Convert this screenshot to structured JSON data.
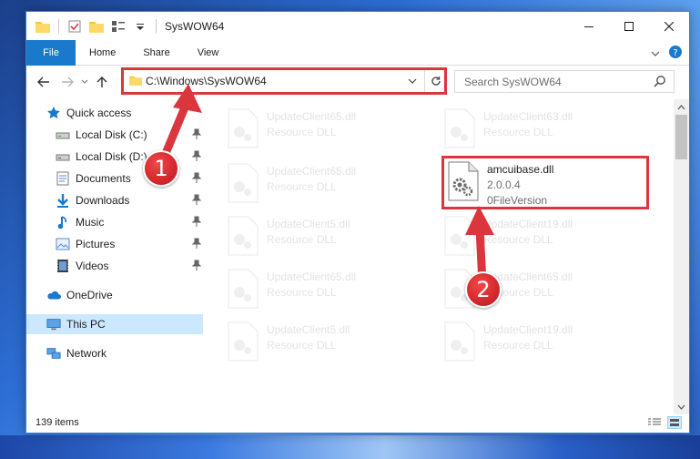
{
  "window": {
    "title": "SysWOW64"
  },
  "ribbon": {
    "tabs": [
      {
        "label": "File"
      },
      {
        "label": "Home"
      },
      {
        "label": "Share"
      },
      {
        "label": "View"
      }
    ]
  },
  "address": {
    "path": "C:\\Windows\\SysWOW64"
  },
  "search": {
    "placeholder": "Search SysWOW64"
  },
  "sidebar": {
    "items": [
      {
        "label": "Quick access",
        "icon": "star-icon",
        "pinned": false
      },
      {
        "label": "Local Disk (C:)",
        "icon": "drive-icon",
        "pinned": true
      },
      {
        "label": "Local Disk (D:)",
        "icon": "drive-icon",
        "pinned": true
      },
      {
        "label": "Documents",
        "icon": "documents-icon",
        "pinned": true
      },
      {
        "label": "Downloads",
        "icon": "download-icon",
        "pinned": true
      },
      {
        "label": "Music",
        "icon": "music-icon",
        "pinned": true
      },
      {
        "label": "Pictures",
        "icon": "pictures-icon",
        "pinned": true
      },
      {
        "label": "Videos",
        "icon": "videos-icon",
        "pinned": true
      },
      {
        "label": "OneDrive",
        "icon": "cloud-icon",
        "pinned": false
      },
      {
        "label": "This PC",
        "icon": "computer-icon",
        "pinned": false,
        "selected": true
      },
      {
        "label": "Network",
        "icon": "network-icon",
        "pinned": false
      }
    ]
  },
  "files": {
    "ghost_left": [
      {
        "name": "UpdateClient65.dll",
        "desc": "Resource DLL"
      },
      {
        "name": "UpdateClient65.dll",
        "desc": "Resource DLL"
      },
      {
        "name": "UpdateClient5.dll",
        "desc": "Resource DLL"
      },
      {
        "name": "UpdateClient65.dll",
        "desc": "Resource DLL"
      },
      {
        "name": "UpdateClient5.dll",
        "desc": "Resource DLL"
      }
    ],
    "ghost_right": [
      {
        "name": "UpdateClient63.dll",
        "desc": "Resource DLL"
      },
      {
        "name": "UpdateClient19.dll",
        "desc": "Resource DLL"
      },
      {
        "name": "UpdateClient65.dll",
        "desc": "Resource DLL"
      },
      {
        "name": "UpdateClient19.dll",
        "desc": "Resource DLL"
      }
    ],
    "selected": {
      "name": "amcuibase.dll",
      "version": "2.0.0.4",
      "desc": "0FileVersion"
    }
  },
  "status": {
    "item_count": "139 items"
  },
  "annotations": {
    "step1": "1",
    "step2": "2",
    "color": "#d9363e"
  }
}
